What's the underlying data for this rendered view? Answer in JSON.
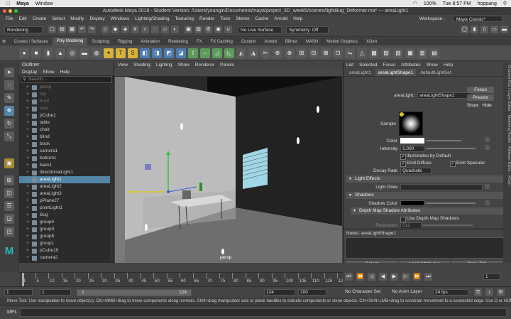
{
  "mac_menu": {
    "app": "Maya",
    "window": "Window",
    "status": "100%",
    "time": "Tue 8:57 PM",
    "user": "hoppang"
  },
  "title": "Autodesk Maya 2018 - Student Version: /Users/youngin/Documents/maya/project_3D_week5/scenes/lightBug_Deformer.ma* --- areaLight1",
  "menus": [
    "File",
    "Edit",
    "Create",
    "Select",
    "Modify",
    "Display",
    "Windows",
    "Lighting/Shading",
    "Texturing",
    "Render",
    "Toon",
    "Stereo",
    "Cache",
    "Arnold",
    "Help"
  ],
  "workspace": {
    "label": "Workspace :",
    "value": "Maya Classic*"
  },
  "status": {
    "mode": "Rendering",
    "live": "No Live Surface",
    "symmetry": "Symmetry: Off"
  },
  "shelf_tabs": [
    "Curves / Surfaces",
    "Poly Modeling",
    "Sculpting",
    "Rigging",
    "Animation",
    "Rendering",
    "FX",
    "FX Caching",
    "Custom",
    "Arnold",
    "Bifrost",
    "MASH",
    "Motion Graphics",
    "XGen"
  ],
  "shelf_active": "Poly Modeling",
  "outliner": {
    "title": "Outliner",
    "menus": [
      "Display",
      "Show",
      "Help"
    ],
    "search": "Search...",
    "items": [
      {
        "name": "persp",
        "dim": true
      },
      {
        "name": "top",
        "dim": true
      },
      {
        "name": "front",
        "dim": true
      },
      {
        "name": "side",
        "dim": true
      },
      {
        "name": "pCube1"
      },
      {
        "name": "table"
      },
      {
        "name": "chair"
      },
      {
        "name": "blind"
      },
      {
        "name": "book"
      },
      {
        "name": "camera1"
      },
      {
        "name": "bottom1"
      },
      {
        "name": "back1"
      },
      {
        "name": "directionalLight1"
      },
      {
        "name": "areaLight1",
        "sel": true
      },
      {
        "name": "areaLight2"
      },
      {
        "name": "areaLight3"
      },
      {
        "name": "pPlane27"
      },
      {
        "name": "pointLight1"
      },
      {
        "name": "Bug"
      },
      {
        "name": "group4"
      },
      {
        "name": "group3"
      },
      {
        "name": "group5"
      },
      {
        "name": "group1"
      },
      {
        "name": "pCube19"
      },
      {
        "name": "camera2"
      }
    ]
  },
  "viewport": {
    "menus": [
      "View",
      "Shading",
      "Lighting",
      "Show",
      "Renderer",
      "Panels"
    ],
    "camera": "persp"
  },
  "attr": {
    "menus": [
      "List",
      "Selected",
      "Focus",
      "Attributes",
      "Show",
      "Help"
    ],
    "tabs": [
      "areaLight1",
      "areaLightShape1",
      "defaultLightSet"
    ],
    "tab_active": "areaLightShape1",
    "node_label": "areaLight:",
    "node_value": "areaLightShape1",
    "focus": "Focus",
    "presets": "Presets",
    "show": "Show",
    "hide": "Hide",
    "sample": "Sample",
    "color": "Color",
    "intensity_label": "Intensity",
    "intensity": "1.000",
    "illum_default": "Illuminates by Default",
    "emit_diffuse": "Emit Diffuse",
    "emit_specular": "Emit Specular",
    "decay_label": "Decay Rate",
    "decay": "Quadratic",
    "sec_effects": "Light Effects",
    "light_glow": "Light Glow",
    "sec_shadows": "Shadows",
    "shadow_color": "Shadow Color",
    "sec_depth": "Depth Map Shadow Attributes",
    "use_depth": "Use Depth Map Shadows",
    "resolution_label": "Resolution",
    "resolution": "512",
    "notes": "Notes:  areaLightShape1",
    "btn_select": "Select",
    "btn_load": "Load Attributes",
    "btn_copy": "Copy Tab"
  },
  "timeline": {
    "ticks": [
      "1",
      "5",
      "10",
      "15",
      "20",
      "25",
      "30",
      "35",
      "40",
      "45",
      "50",
      "55",
      "60",
      "65",
      "70",
      "75",
      "80",
      "85",
      "90",
      "95",
      "100",
      "105",
      "110",
      "115",
      "120"
    ],
    "current": "1"
  },
  "range": {
    "start": "1",
    "anim_start": "1",
    "slider_start": "1",
    "slider_end": "124",
    "anim_end": "124",
    "end": "200",
    "charset": "No Character Set",
    "animlayer": "No Anim Layer",
    "fps": "24 fps"
  },
  "help": "Move Tool: Use manipulator to move object(s). Ctrl+MMB+drag to move components along normals. Shift+drag manipulator axis or plane handles to extrude components or clone objects. Ctrl+Shift+LMB+drag to constrain movement to a connected edge. Use D or HOME to change the pi",
  "mel": "MEL"
}
